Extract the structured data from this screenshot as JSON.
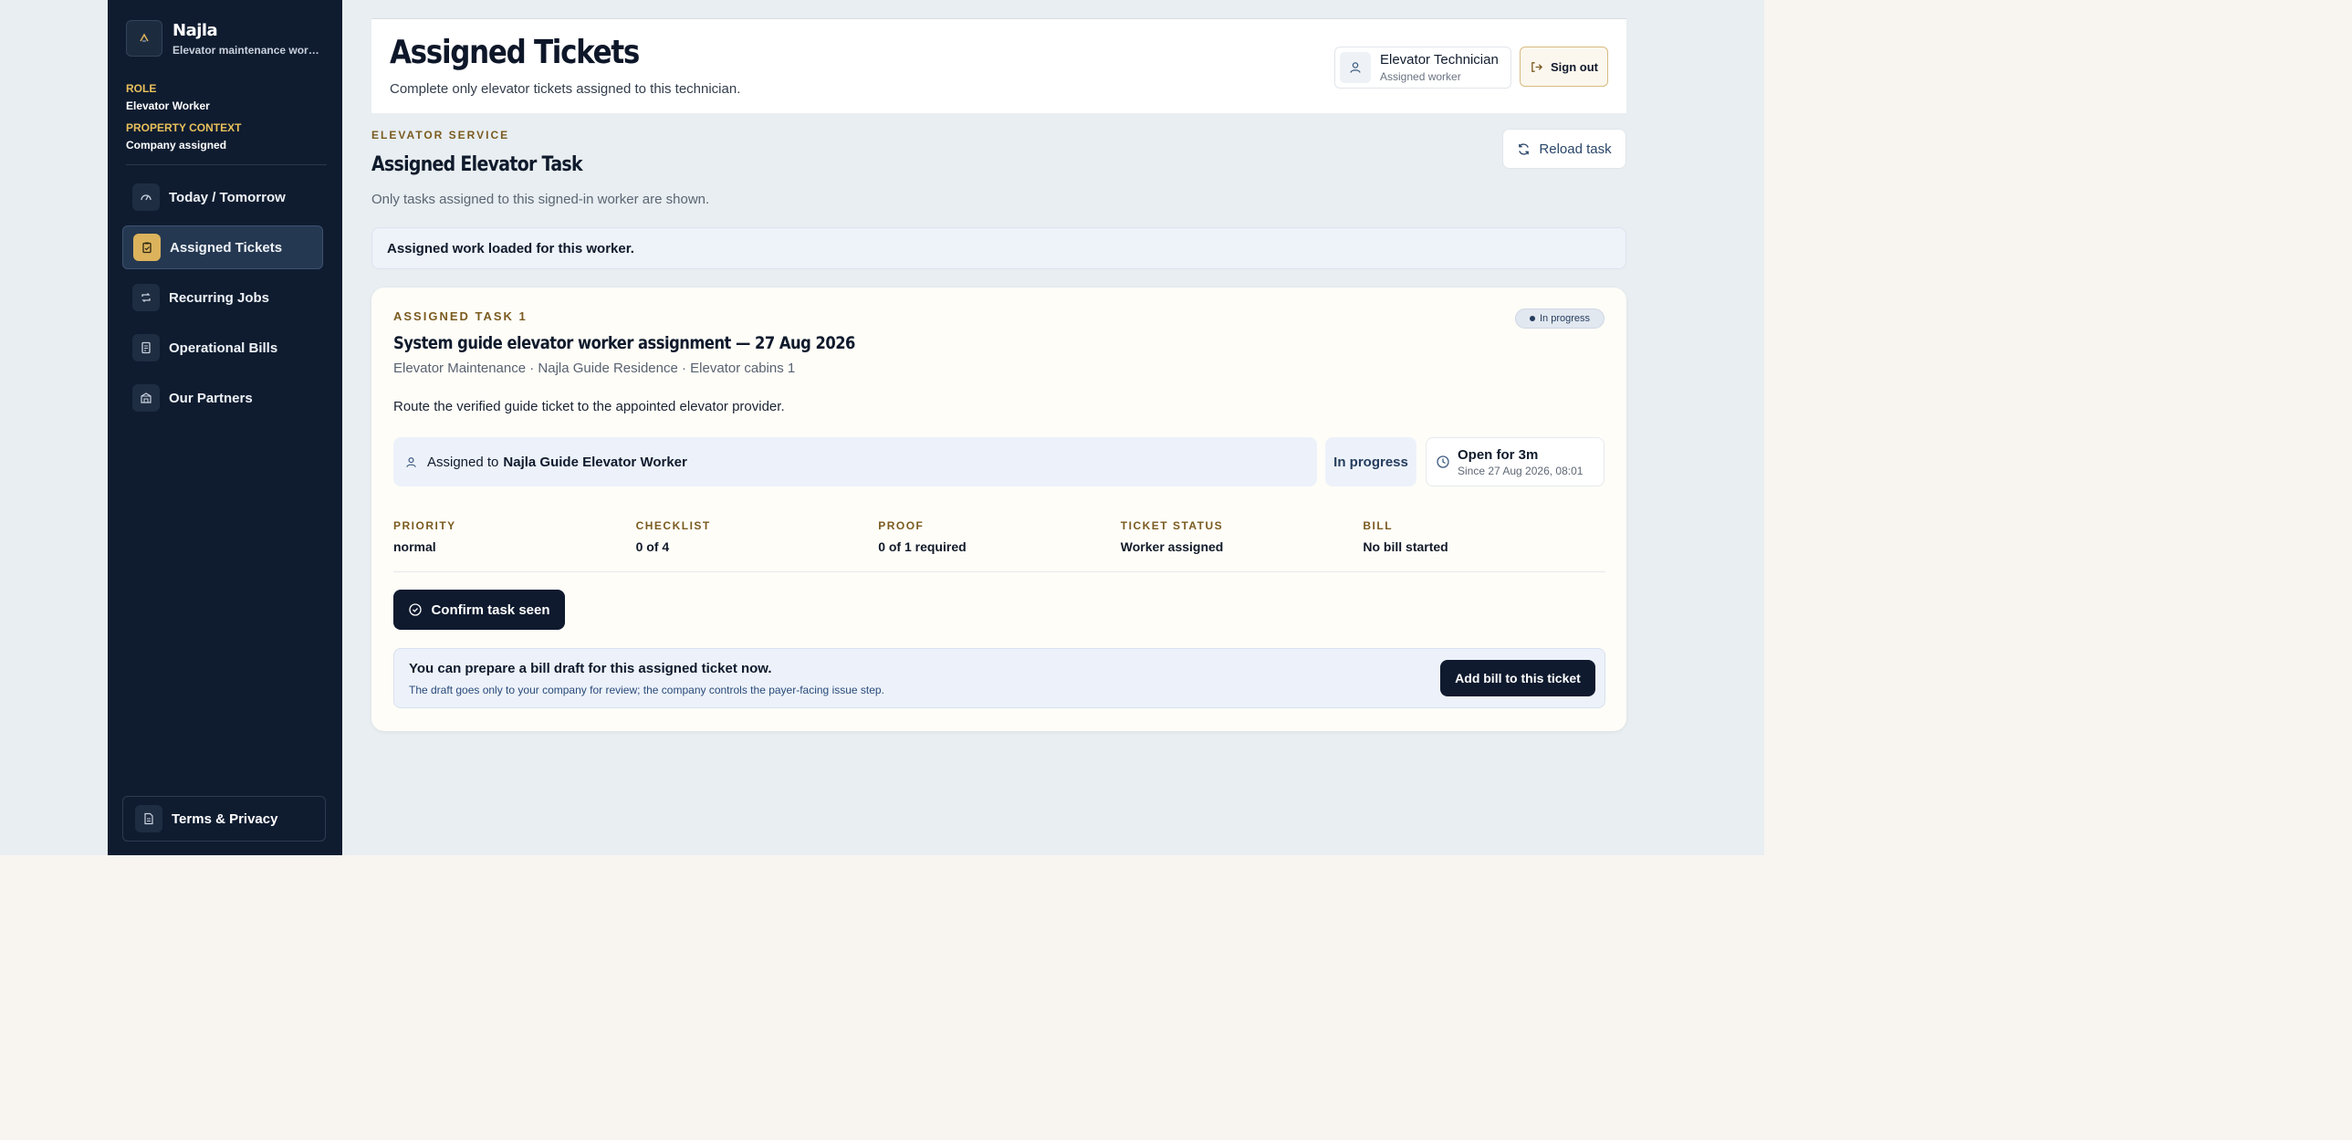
{
  "brand": {
    "name": "Najla",
    "subtitle": "Elevator maintenance worker"
  },
  "sidebar": {
    "role_label": "ROLE",
    "role_value": "Elevator Worker",
    "context_label": "PROPERTY CONTEXT",
    "context_value": "Company assigned",
    "items": [
      {
        "label": "Today / Tomorrow",
        "icon": "gauge-icon"
      },
      {
        "label": "Assigned Tickets",
        "icon": "clipboard-icon",
        "active": true
      },
      {
        "label": "Recurring Jobs",
        "icon": "repeat-icon"
      },
      {
        "label": "Operational Bills",
        "icon": "receipt-icon"
      },
      {
        "label": "Our Partners",
        "icon": "building-icon"
      }
    ],
    "terms_label": "Terms & Privacy"
  },
  "header": {
    "title": "Assigned Tickets",
    "subtitle": "Complete only elevator tickets assigned to this technician.",
    "tech_name": "Elevator Technician",
    "tech_role": "Assigned worker",
    "signout_label": "Sign out"
  },
  "section": {
    "kicker": "ELEVATOR SERVICE",
    "title": "Assigned Elevator Task",
    "subtitle": "Only tasks assigned to this signed-in worker are shown.",
    "reload_label": "Reload task",
    "notice": "Assigned work loaded for this worker."
  },
  "task": {
    "kicker": "ASSIGNED TASK 1",
    "badge": "In progress",
    "title": "System guide elevator worker assignment — 27 Aug 2026",
    "meta": "Elevator Maintenance · Najla Guide Residence · Elevator cabins 1",
    "description": "Route the verified guide ticket to the appointed elevator provider.",
    "assigned_prefix": "Assigned to",
    "assigned_to": "Najla Guide Elevator Worker",
    "status": "In progress",
    "open_for": "Open for 3m",
    "open_since": "Since 27 Aug 2026, 08:01",
    "stats": [
      {
        "label": "PRIORITY",
        "value": "normal"
      },
      {
        "label": "CHECKLIST",
        "value": "0 of 4"
      },
      {
        "label": "PROOF",
        "value": "0 of 1 required"
      },
      {
        "label": "TICKET STATUS",
        "value": "Worker assigned"
      },
      {
        "label": "BILL",
        "value": "No bill started"
      }
    ],
    "confirm_label": "Confirm task seen",
    "bill_title": "You can prepare a bill draft for this assigned ticket now.",
    "bill_sub": "The draft goes only to your company for review; the company controls the payer-facing issue step.",
    "bill_button": "Add bill to this ticket"
  },
  "colors": {
    "sidebar_bg": "#0f1c30",
    "accent_gold": "#dcb35c",
    "page_bg": "#e8eef1",
    "primary_button": "#0f1a2e"
  }
}
